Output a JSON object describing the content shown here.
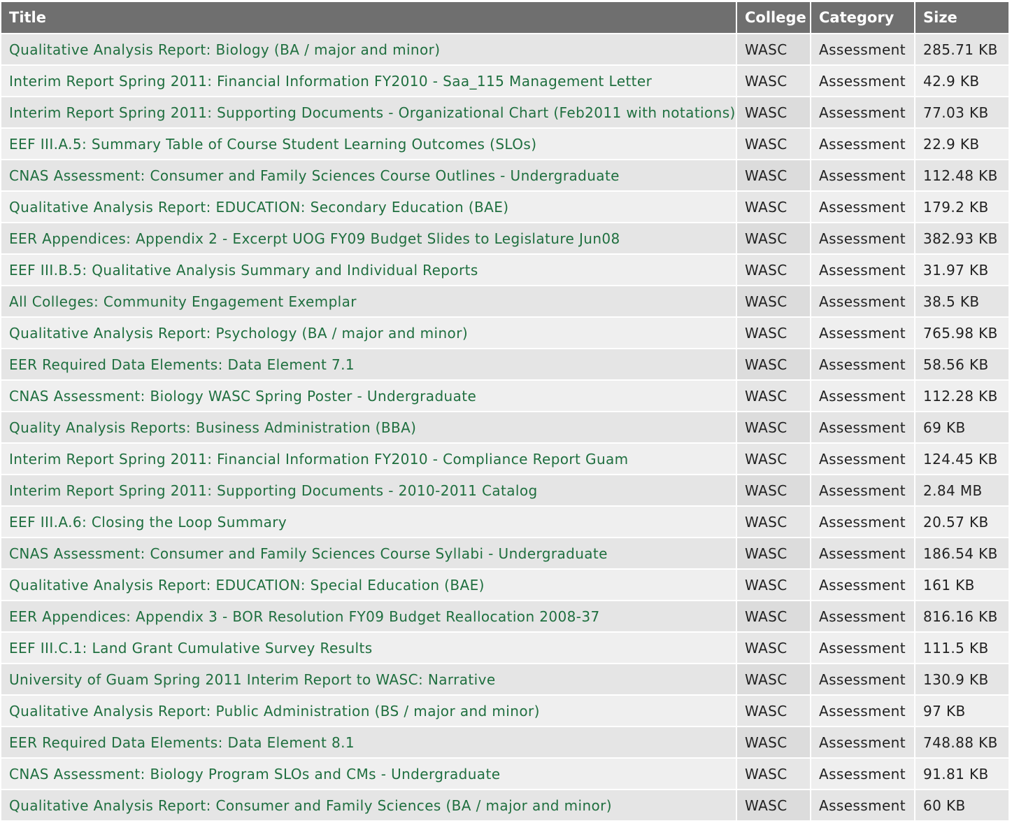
{
  "table": {
    "headers": {
      "title": "Title",
      "college": "College",
      "category": "Category",
      "size": "Size"
    },
    "rows": [
      {
        "title": "Qualitative Analysis Report: Biology (BA / major and minor)",
        "college": "WASC",
        "category": "Assessment",
        "size": "285.71 KB"
      },
      {
        "title": "Interim Report Spring 2011: Financial Information FY2010 - Saa_115 Management Letter",
        "college": "WASC",
        "category": "Assessment",
        "size": "42.9 KB"
      },
      {
        "title": "Interim Report Spring 2011: Supporting Documents - Organizational Chart (Feb2011 with notations)",
        "college": "WASC",
        "category": "Assessment",
        "size": "77.03 KB"
      },
      {
        "title": "EEF III.A.5: Summary Table of Course Student Learning Outcomes (SLOs)",
        "college": "WASC",
        "category": "Assessment",
        "size": "22.9 KB"
      },
      {
        "title": "CNAS Assessment: Consumer and Family Sciences Course Outlines - Undergraduate",
        "college": "WASC",
        "category": "Assessment",
        "size": "112.48 KB"
      },
      {
        "title": "Qualitative Analysis Report: EDUCATION: Secondary Education (BAE)",
        "college": "WASC",
        "category": "Assessment",
        "size": "179.2 KB"
      },
      {
        "title": "EER Appendices: Appendix 2 - Excerpt UOG FY09 Budget Slides to Legislature Jun08",
        "college": "WASC",
        "category": "Assessment",
        "size": "382.93 KB"
      },
      {
        "title": "EEF III.B.5: Qualitative Analysis Summary and Individual Reports",
        "college": "WASC",
        "category": "Assessment",
        "size": "31.97 KB"
      },
      {
        "title": "All Colleges: Community Engagement Exemplar",
        "college": "WASC",
        "category": "Assessment",
        "size": "38.5 KB"
      },
      {
        "title": "Qualitative Analysis Report: Psychology (BA / major and minor)",
        "college": "WASC",
        "category": "Assessment",
        "size": "765.98 KB"
      },
      {
        "title": "EER Required Data Elements: Data Element 7.1",
        "college": "WASC",
        "category": "Assessment",
        "size": "58.56 KB"
      },
      {
        "title": "CNAS Assessment: Biology WASC Spring Poster - Undergraduate",
        "college": "WASC",
        "category": "Assessment",
        "size": "112.28 KB"
      },
      {
        "title": "Quality Analysis Reports: Business Administration (BBA)",
        "college": "WASC",
        "category": "Assessment",
        "size": "69 KB"
      },
      {
        "title": "Interim Report Spring 2011: Financial Information FY2010 - Compliance Report Guam",
        "college": "WASC",
        "category": "Assessment",
        "size": "124.45 KB"
      },
      {
        "title": "Interim Report Spring 2011: Supporting Documents - 2010-2011 Catalog",
        "college": "WASC",
        "category": "Assessment",
        "size": "2.84 MB"
      },
      {
        "title": "EEF III.A.6: Closing the Loop Summary",
        "college": "WASC",
        "category": "Assessment",
        "size": "20.57 KB"
      },
      {
        "title": "CNAS Assessment: Consumer and Family Sciences Course Syllabi - Undergraduate",
        "college": "WASC",
        "category": "Assessment",
        "size": "186.54 KB"
      },
      {
        "title": "Qualitative Analysis Report: EDUCATION: Special Education (BAE)",
        "college": "WASC",
        "category": "Assessment",
        "size": "161 KB"
      },
      {
        "title": "EER Appendices: Appendix 3 - BOR Resolution FY09 Budget Reallocation 2008-37",
        "college": "WASC",
        "category": "Assessment",
        "size": "816.16 KB"
      },
      {
        "title": "EEF III.C.1: Land Grant Cumulative Survey Results",
        "college": "WASC",
        "category": "Assessment",
        "size": "111.5 KB"
      },
      {
        "title": "University of Guam Spring 2011 Interim Report to WASC: Narrative",
        "college": "WASC",
        "category": "Assessment",
        "size": "130.9 KB"
      },
      {
        "title": "Qualitative Analysis Report: Public Administration (BS / major and minor)",
        "college": "WASC",
        "category": "Assessment",
        "size": "97 KB"
      },
      {
        "title": "EER Required Data Elements: Data Element 8.1",
        "college": "WASC",
        "category": "Assessment",
        "size": "748.88 KB"
      },
      {
        "title": "CNAS Assessment: Biology Program SLOs and CMs - Undergraduate",
        "college": "WASC",
        "category": "Assessment",
        "size": "91.81 KB"
      },
      {
        "title": "Qualitative Analysis Report: Consumer and Family Sciences (BA / major and minor)",
        "college": "WASC",
        "category": "Assessment",
        "size": "60 KB"
      }
    ]
  },
  "colors": {
    "header_bg": "#6f6f6f",
    "link": "#1f6f3f",
    "row_odd": "#e5e5e5",
    "row_even": "#efefef"
  }
}
